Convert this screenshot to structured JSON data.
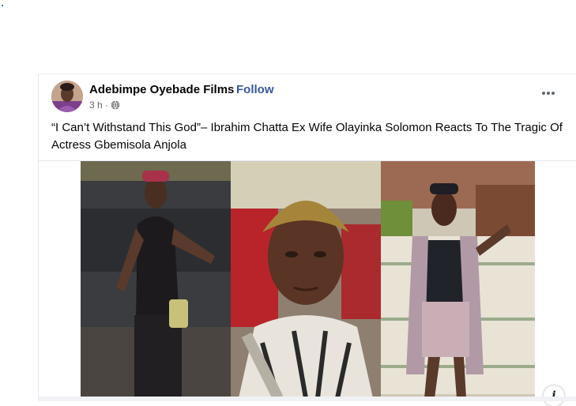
{
  "post": {
    "author": "Adebimpe Oyebade Films",
    "separator": "·",
    "follow_label": "Follow",
    "time": "3 h ·",
    "caption": "“I Can’t Withstand This God”– Ibrahim Chatta Ex Wife Olayinka Solomon Reacts To The Tragic Of Actress Gbemisola Anjola",
    "info_label": "i"
  },
  "icons": {
    "audience": "globe-icon",
    "menu": "more-options-icon",
    "info": "info-icon"
  },
  "colors": {
    "link": "#385898",
    "text": "#050505",
    "muted": "#65676b"
  }
}
